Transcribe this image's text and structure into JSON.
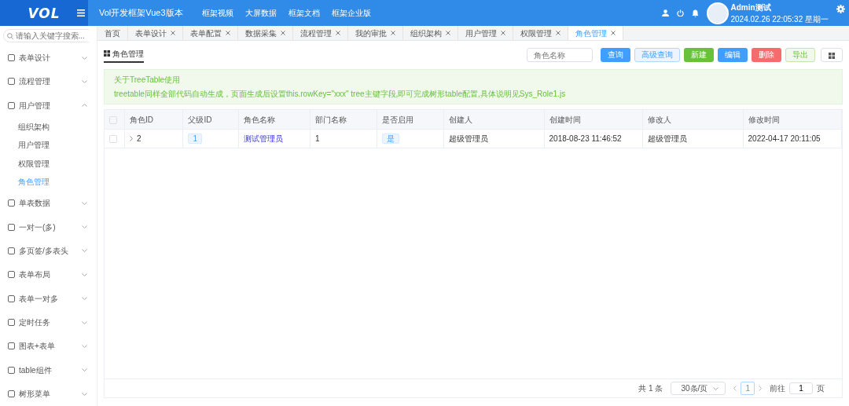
{
  "header": {
    "logo": "VOL",
    "title": "Vol开发框架Vue3版本",
    "nav": [
      "框架视频",
      "大屏数据",
      "框架文档",
      "框架企业版"
    ],
    "user": {
      "name": "Admin测试",
      "datetime": "2024.02.26 22:05:32 星期一"
    }
  },
  "sidebar": {
    "search_placeholder": "请输入关键字搜索...",
    "items": [
      {
        "label": "表单设计",
        "expanded": false
      },
      {
        "label": "流程管理",
        "expanded": false
      },
      {
        "label": "用户管理",
        "expanded": true,
        "children": [
          {
            "label": "组织架构",
            "selected": false
          },
          {
            "label": "用户管理",
            "selected": false
          },
          {
            "label": "权限管理",
            "selected": false
          },
          {
            "label": "角色管理",
            "selected": true
          }
        ]
      },
      {
        "label": "单表数据",
        "expanded": false
      },
      {
        "label": "一对一(多)",
        "expanded": false
      },
      {
        "label": "多页签/多表头",
        "expanded": false
      },
      {
        "label": "表单布局",
        "expanded": false
      },
      {
        "label": "表单一对多",
        "expanded": false
      },
      {
        "label": "定时任务",
        "expanded": false
      },
      {
        "label": "图表+表单",
        "expanded": false
      },
      {
        "label": "table组件",
        "expanded": false
      },
      {
        "label": "树形菜单",
        "expanded": false
      }
    ]
  },
  "tabs": [
    {
      "label": "首页",
      "closable": false,
      "selected": false
    },
    {
      "label": "表单设计",
      "closable": true,
      "selected": false
    },
    {
      "label": "表单配置",
      "closable": true,
      "selected": false
    },
    {
      "label": "数据采集",
      "closable": true,
      "selected": false
    },
    {
      "label": "流程管理",
      "closable": true,
      "selected": false
    },
    {
      "label": "我的审批",
      "closable": true,
      "selected": false
    },
    {
      "label": "组织架构",
      "closable": true,
      "selected": false
    },
    {
      "label": "用户管理",
      "closable": true,
      "selected": false
    },
    {
      "label": "权限管理",
      "closable": true,
      "selected": false
    },
    {
      "label": "角色管理",
      "closable": true,
      "selected": true
    }
  ],
  "page": {
    "title": "角色管理",
    "search_placeholder": "角色名称",
    "buttons": [
      {
        "label": "查询",
        "kind": "primary"
      },
      {
        "label": "高级查询",
        "kind": "light-primary"
      },
      {
        "label": "新建",
        "kind": "success"
      },
      {
        "label": "编辑",
        "kind": "primary"
      },
      {
        "label": "删除",
        "kind": "danger"
      },
      {
        "label": "导出",
        "kind": "light-success"
      }
    ],
    "notice": {
      "title": "关于TreeTable使用",
      "text": "treetable同样全部代码自动生成，页面生成后设置this.rowKey=\"xxx\" tree主键字段,即可完成树形table配置,具体说明见Sys_Role1.js"
    }
  },
  "table": {
    "columns": [
      {
        "label": "角色ID",
        "kind": "tree"
      },
      {
        "label": "父级ID",
        "kind": "tag"
      },
      {
        "label": "角色名称",
        "kind": "link"
      },
      {
        "label": "部门名称",
        "kind": "text"
      },
      {
        "label": "是否启用",
        "kind": "tag"
      },
      {
        "label": "创建人",
        "kind": "text"
      },
      {
        "label": "创建时间",
        "kind": "text"
      },
      {
        "label": "修改人",
        "kind": "text"
      },
      {
        "label": "修改时间",
        "kind": "text"
      }
    ],
    "all_checked": false,
    "rows": [
      {
        "checked": false,
        "cells": [
          "2",
          "1",
          "测试管理员",
          "1",
          "是",
          "超级管理员",
          "2018-08-23 11:46:52",
          "超级管理员",
          "2022-04-17 20:11:05"
        ]
      }
    ]
  },
  "pagination": {
    "total": "共 1 条",
    "page_size": "30条/页",
    "current": "1",
    "goto_label": "前往",
    "goto_value": "1",
    "page_unit": "页"
  }
}
